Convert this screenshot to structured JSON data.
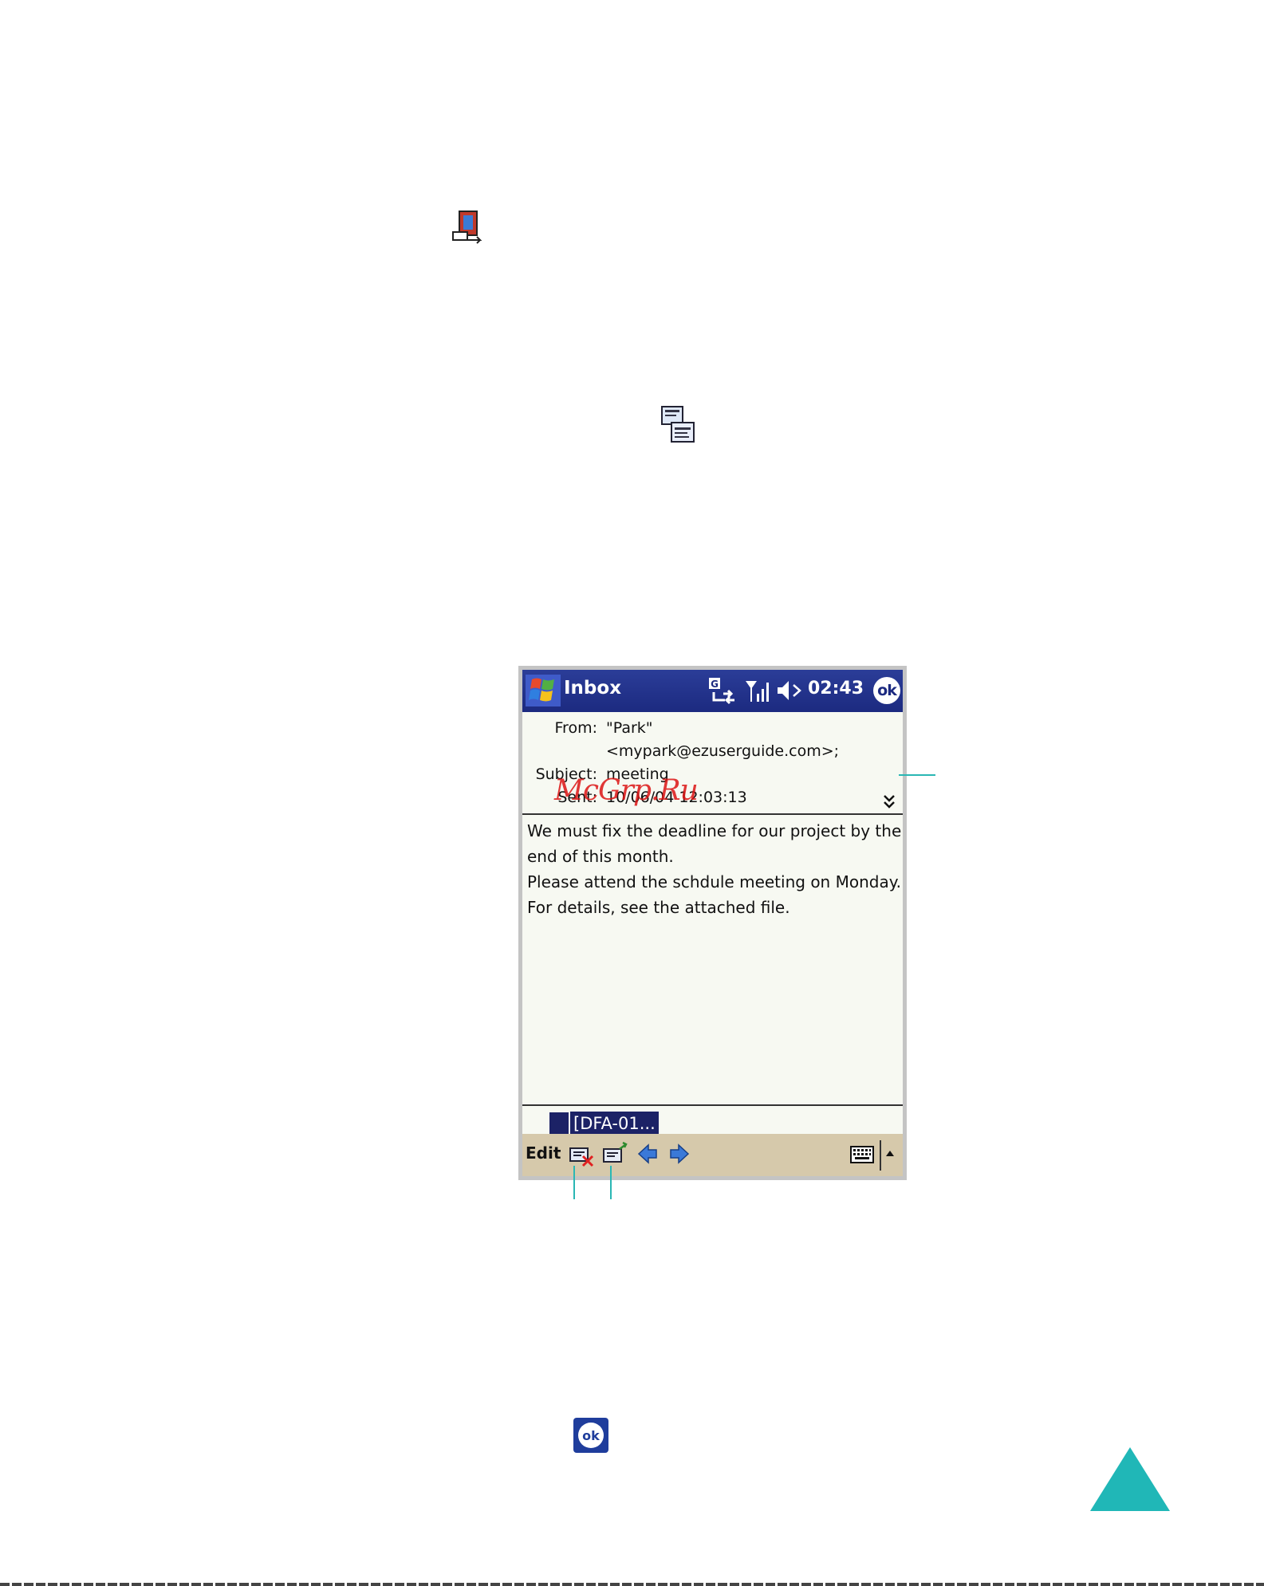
{
  "screen": {
    "titlebar": {
      "app_title": "Inbox",
      "clock": "02:43",
      "ok_label": "ok"
    },
    "message": {
      "from_label": "From:",
      "from_name": "\"Park\"",
      "from_address": "<mypark@ezuserguide.com>;",
      "subject_label": "Subject:",
      "subject": "meeting",
      "sent_label": "Sent:",
      "sent": "10/06/04 12:03:13",
      "body_lines": [
        "We must fix the deadline for our project by the",
        "end of this  month.",
        "Please attend the schdule meeting on Monday.",
        "For details, see the attached file."
      ],
      "attachment": "[DFA-01..."
    },
    "toolbar": {
      "edit_label": "Edit"
    }
  },
  "watermark": "McGrp.Ru",
  "page_icons": {
    "ok_label": "ok"
  },
  "colors": {
    "titlebar": "#1c2a80",
    "toolbar": "#d6c9ab",
    "callout": "#2ab7b4",
    "watermark": "#dc1414"
  }
}
